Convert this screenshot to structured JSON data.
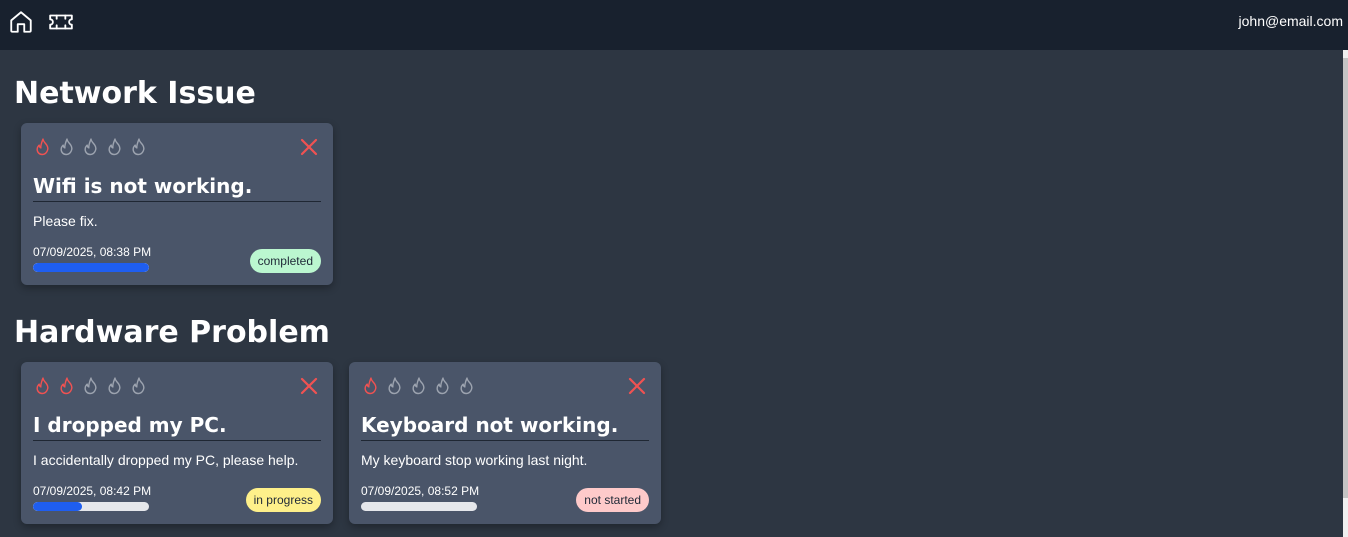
{
  "nav": {
    "home_icon": "home-icon",
    "tickets_icon": "ticket-icon",
    "user_email": "john@email.com"
  },
  "colors": {
    "nav_bg": "#18212e",
    "page_bg": "#2d3642",
    "card_bg": "#4a5569",
    "flame_active": "#f05252",
    "flame_inactive": "#9ca3af",
    "close": "#f05252",
    "progress_fill": "#1f5ef0"
  },
  "categories": [
    {
      "name": "Network Issue",
      "tickets": [
        {
          "title": "Wifi is not working.",
          "description": "Please fix.",
          "date": "07/09/2025, 08:38 PM",
          "priority": 1,
          "priority_max": 5,
          "progress": 1.0,
          "status": "completed",
          "status_color": "#bbf7d0"
        }
      ]
    },
    {
      "name": "Hardware Problem",
      "tickets": [
        {
          "title": "I dropped my PC.",
          "description": "I accidentally dropped my PC, please help.",
          "date": "07/09/2025, 08:42 PM",
          "priority": 2,
          "priority_max": 5,
          "progress": 0.42,
          "status": "in progress",
          "status_color": "#fef08a"
        },
        {
          "title": "Keyboard not working.",
          "description": "My keyboard stop working last night.",
          "date": "07/09/2025, 08:52 PM",
          "priority": 1,
          "priority_max": 5,
          "progress": 0.0,
          "status": "not started",
          "status_color": "#fecaca"
        }
      ]
    }
  ]
}
